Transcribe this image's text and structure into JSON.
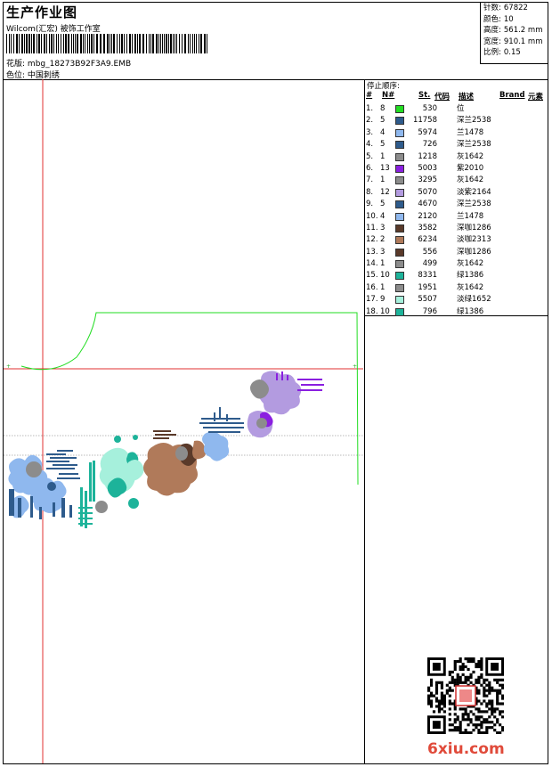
{
  "header": {
    "title": "生产作业图",
    "company": "Wilcom(汇宏) 被饰工作室",
    "design_label": "花版:",
    "design_file": "mbg_18273B92F3A9.EMB",
    "colorway_label": "色位:",
    "colorway": "中国刺绣"
  },
  "stats": [
    {
      "label": "针数:",
      "value": "67822"
    },
    {
      "label": "颜色:",
      "value": "10"
    },
    {
      "label": "高度:",
      "value": "561.2 mm"
    },
    {
      "label": "宽度:",
      "value": "910.1 mm"
    },
    {
      "label": "比例:",
      "value": "0.15"
    }
  ],
  "panel": {
    "stop_order_label": "停止顺序:",
    "columns": [
      "#",
      "N#",
      "St.",
      "代码",
      "描述",
      "Brand",
      "元素"
    ],
    "rows": [
      {
        "idx": "1.",
        "needle": "8",
        "color": "#22dd22",
        "stitches": "530",
        "desc": "位"
      },
      {
        "idx": "2.",
        "needle": "5",
        "color": "#2e5b8c",
        "stitches": "11758",
        "desc": "深兰2538"
      },
      {
        "idx": "3.",
        "needle": "4",
        "color": "#8fb8ee",
        "stitches": "5974",
        "desc": "兰1478"
      },
      {
        "idx": "4.",
        "needle": "5",
        "color": "#2e5b8c",
        "stitches": "726",
        "desc": "深兰2538"
      },
      {
        "idx": "5.",
        "needle": "1",
        "color": "#8c8c8c",
        "stitches": "1218",
        "desc": "灰1642"
      },
      {
        "idx": "6.",
        "needle": "13",
        "color": "#8a1fe0",
        "stitches": "5003",
        "desc": "紫2010"
      },
      {
        "idx": "7.",
        "needle": "1",
        "color": "#8c8c8c",
        "stitches": "3295",
        "desc": "灰1642"
      },
      {
        "idx": "8.",
        "needle": "12",
        "color": "#b39be0",
        "stitches": "5070",
        "desc": "淡紫2164"
      },
      {
        "idx": "9.",
        "needle": "5",
        "color": "#2e5b8c",
        "stitches": "4670",
        "desc": "深兰2538"
      },
      {
        "idx": "10.",
        "needle": "4",
        "color": "#8fb8ee",
        "stitches": "2120",
        "desc": "兰1478"
      },
      {
        "idx": "11.",
        "needle": "3",
        "color": "#5a3a2a",
        "stitches": "3582",
        "desc": "深咖1286"
      },
      {
        "idx": "12.",
        "needle": "2",
        "color": "#b07a5a",
        "stitches": "6234",
        "desc": "淡咖2313"
      },
      {
        "idx": "13.",
        "needle": "3",
        "color": "#5a3a2a",
        "stitches": "556",
        "desc": "深咖1286"
      },
      {
        "idx": "14.",
        "needle": "1",
        "color": "#8c8c8c",
        "stitches": "499",
        "desc": "灰1642"
      },
      {
        "idx": "15.",
        "needle": "10",
        "color": "#1db39a",
        "stitches": "8331",
        "desc": "绿1386"
      },
      {
        "idx": "16.",
        "needle": "1",
        "color": "#8c8c8c",
        "stitches": "1951",
        "desc": "灰1642"
      },
      {
        "idx": "17.",
        "needle": "9",
        "color": "#a6f0dc",
        "stitches": "5507",
        "desc": "淡绿1652"
      },
      {
        "idx": "18.",
        "needle": "10",
        "color": "#1db39a",
        "stitches": "796",
        "desc": "绿1386"
      }
    ]
  },
  "watermark": "6xiu.com"
}
